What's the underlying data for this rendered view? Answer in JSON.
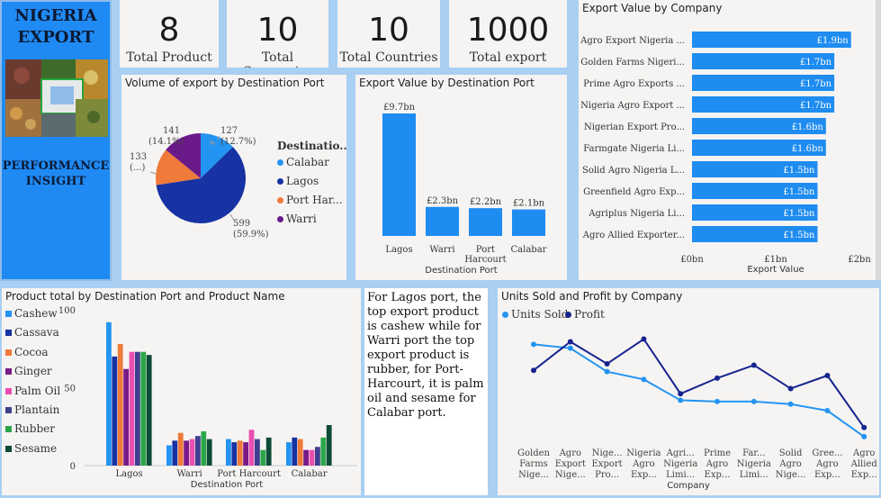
{
  "sidebar": {
    "title_line1": "NIGERIA",
    "title_line2": "EXPORT",
    "subtitle_line1": "PERFORMANCE",
    "subtitle_line2": "INSIGHT"
  },
  "kpis": [
    {
      "value": "8",
      "label": "Total Product"
    },
    {
      "value": "10",
      "label": "Total Companies"
    },
    {
      "value": "10",
      "label": "Total Countries"
    },
    {
      "value": "1000",
      "label": "Total export"
    }
  ],
  "colors": {
    "calabar": "#2394f2",
    "lagos": "#1632a3",
    "port_harcourt": "#ef7a3a",
    "warri": "#6a1989",
    "ginger": "#7a1a88",
    "palm_oil": "#e84fb0",
    "plantain": "#3f3f8f",
    "rubber": "#2ca64a",
    "sesame": "#0e4a38",
    "bar": "#1e8cf0",
    "profit": "#16238f"
  },
  "insight_text": "For Lagos port, the top export product is cashew while for Warri port the top export product is rubber, for Port-Harcourt, it is palm oil and sesame for Calabar port.",
  "chart_data": [
    {
      "type": "pie",
      "title": "Volume of export by Destination Port",
      "legend_title": "Destinatio...",
      "slices": [
        {
          "name": "Calabar",
          "value": 127,
          "label": "127\n(12.7%)"
        },
        {
          "name": "Lagos",
          "value": 599,
          "label": "599\n(59.9%)"
        },
        {
          "name": "Port Har...",
          "value": 133,
          "label": "133\n(...)"
        },
        {
          "name": "Warri",
          "value": 141,
          "label": "141\n(14.1%)"
        }
      ]
    },
    {
      "type": "bar",
      "title": "Export Value by Destination Port",
      "xlabel": "Destination Port",
      "categories": [
        "Lagos",
        "Warri",
        "Port\nHarcourt",
        "Calabar"
      ],
      "values": [
        9.7,
        2.3,
        2.2,
        2.1
      ],
      "data_labels": [
        "£9.7bn",
        "£2.3bn",
        "£2.2bn",
        "£2.1bn"
      ]
    },
    {
      "type": "bar",
      "orientation": "horizontal",
      "title": "Export Value by Company",
      "xlabel": "Export Value",
      "xlim": [
        0,
        2
      ],
      "xticks": [
        "£0bn",
        "£1bn",
        "£2bn"
      ],
      "categories": [
        "Agro Export Nigeria ...",
        "Golden Farms Nigeri...",
        "Prime Agro Exports ...",
        "Nigeria Agro Export ...",
        "Nigerian Export Pro...",
        "Farmgate Nigeria Li...",
        "Solid Agro Nigeria L...",
        "Greenfield Agro Exp...",
        "Agriplus Nigeria Li...",
        "Agro Allied Exporter..."
      ],
      "values": [
        1.9,
        1.7,
        1.7,
        1.7,
        1.6,
        1.6,
        1.5,
        1.5,
        1.5,
        1.5
      ],
      "data_labels": [
        "£1.9bn",
        "£1.7bn",
        "£1.7bn",
        "£1.7bn",
        "£1.6bn",
        "£1.6bn",
        "£1.5bn",
        "£1.5bn",
        "£1.5bn",
        "£1.5bn"
      ]
    },
    {
      "type": "bar",
      "title": "Product total by Destination Port and Product Name",
      "xlabel": "Destination Port",
      "ylim": [
        0,
        100
      ],
      "yticks": [
        "0",
        "50",
        "100"
      ],
      "categories": [
        "Lagos",
        "Warri",
        "Port Harcourt",
        "Calabar"
      ],
      "series": [
        {
          "name": "Cashew",
          "values": [
            92,
            13,
            17,
            15
          ]
        },
        {
          "name": "Cassava",
          "values": [
            70,
            16,
            15,
            18
          ]
        },
        {
          "name": "Cocoa",
          "values": [
            78,
            21,
            16,
            17
          ]
        },
        {
          "name": "Ginger",
          "values": [
            62,
            16,
            15,
            10
          ]
        },
        {
          "name": "Palm Oil",
          "values": [
            73,
            17,
            23,
            10
          ]
        },
        {
          "name": "Plantain",
          "values": [
            73,
            19,
            17,
            12
          ]
        },
        {
          "name": "Rubber",
          "values": [
            73,
            22,
            10,
            18
          ]
        },
        {
          "name": "Sesame",
          "values": [
            71,
            17,
            18,
            26
          ]
        }
      ]
    },
    {
      "type": "line",
      "title": "Units Sold and Profit by Company",
      "xlabel": "Company",
      "categories": [
        "Golden\nFarms\nNige...",
        "Agro\nExport\nNige...",
        "Nige...\nExport\nPro...",
        "Nigeria\nAgro\nExp...",
        "Agri...\nNigeria\nLimi...",
        "Prime\nAgro\nExp...",
        "Far...\nNigeria\nLimi...",
        "Solid\nAgro\nNige...",
        "Gree...\nAgro\nExp...",
        "Agro\nAllied\nExp..."
      ],
      "series": [
        {
          "name": "Units Sold",
          "values": [
            118,
            115,
            97,
            91,
            75,
            74,
            74,
            72,
            67,
            47
          ]
        },
        {
          "name": "Profit",
          "values": [
            98,
            120,
            103,
            122,
            80,
            92,
            102,
            84,
            94,
            54
          ]
        }
      ]
    }
  ]
}
